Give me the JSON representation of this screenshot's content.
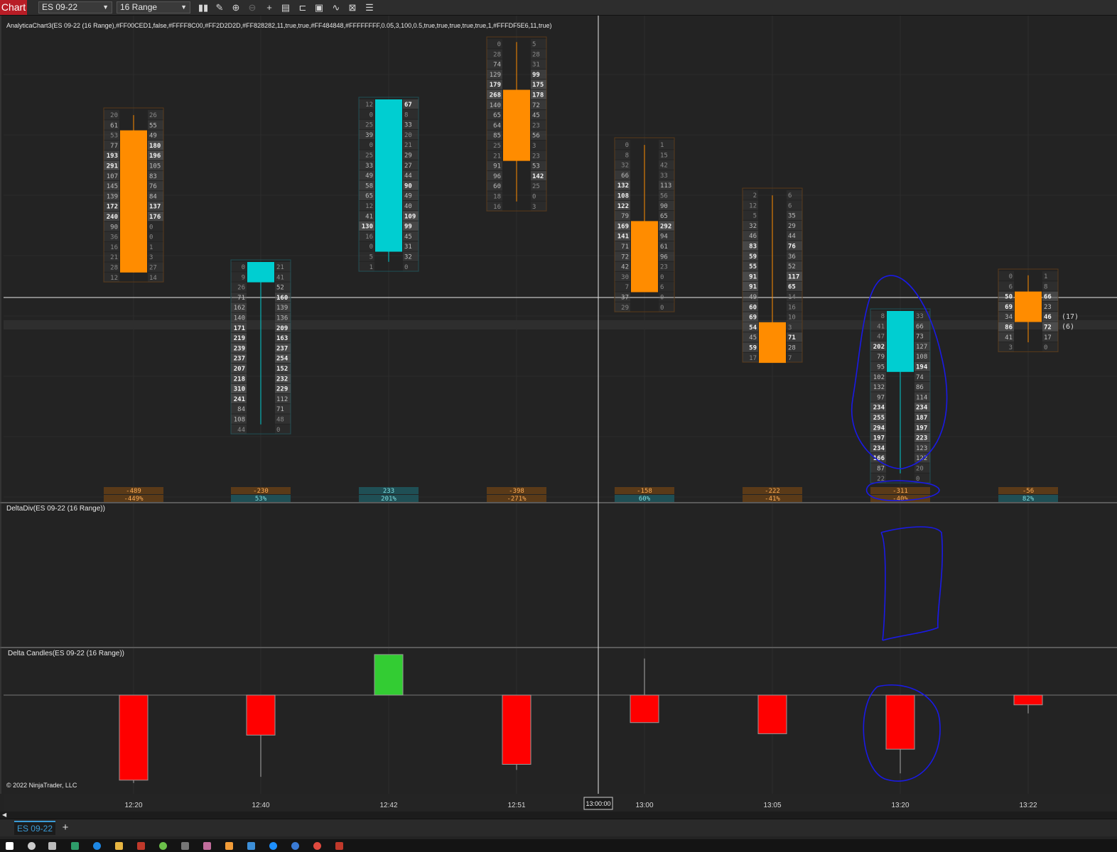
{
  "toolbar": {
    "chart_label": "Chart",
    "instrument": "ES 09-22",
    "interval": "16 Range",
    "icons": [
      "bar-type-icon",
      "draw-tool-icon",
      "zoom-in-icon",
      "zoom-out-icon",
      "crosshair-icon",
      "data-box-icon",
      "properties-icon",
      "screenshot-icon",
      "strategies-icon",
      "indicators-icon",
      "list-icon"
    ]
  },
  "panels": {
    "main_label": "AnalyticaChart3(ES 09-22 (16 Range),#FF00CED1,false,#FFFF8C00,#FF2D2D2D,#FF828282,11,true,true,#FF484848,#FFFFFFFF,0.05,3,100,0.5,true,true,true,true,true,1,#FFFDF5E6,11,true)",
    "delta_div_label": "DeltaDiv(ES 09-22 (16 Range))",
    "delta_candles_label": "Delta Candles(ES 09-22 (16 Range))",
    "copyright": "© 2022 NinjaTrader, LLC"
  },
  "colors": {
    "bg": "#232323",
    "bull": "#00CED1",
    "bear": "#FF8C00",
    "grid": "#2D2D2D",
    "delta_up": "#33CC33",
    "delta_down": "#FF0000",
    "annotation": "#1A1AE6"
  },
  "x_axis": {
    "cursor_time": "13:00:00",
    "labels": [
      "12:20",
      "12:40",
      "12:42",
      "12:51",
      "13:00",
      "13:05",
      "13:20",
      "13:22"
    ]
  },
  "price_markers": [
    "(17)",
    "(6)"
  ],
  "chart_data": {
    "type": "footprint",
    "bars": [
      {
        "time": "12:20",
        "dir": "down",
        "bid": [
          "20",
          "61",
          "53",
          "77",
          "193",
          "291",
          "107",
          "145",
          "139",
          "172",
          "240",
          "90",
          "36",
          "16",
          "21",
          "28",
          "12"
        ],
        "ask": [
          "26",
          "55",
          "49",
          "180",
          "196",
          "105",
          "83",
          "76",
          "84",
          "137",
          "176",
          "0",
          "0",
          "1",
          "3",
          "27",
          "14"
        ],
        "delta": "-489",
        "pct": "-449%"
      },
      {
        "time": "12:40",
        "dir": "up",
        "bid": [
          "0",
          "9",
          "26",
          "71",
          "162",
          "140",
          "171",
          "219",
          "239",
          "237",
          "207",
          "218",
          "310",
          "241",
          "84",
          "108",
          "44"
        ],
        "ask": [
          "21",
          "41",
          "52",
          "160",
          "139",
          "136",
          "209",
          "163",
          "237",
          "254",
          "152",
          "232",
          "229",
          "112",
          "71",
          "48",
          "0"
        ],
        "delta": "-230",
        "pct": "53%"
      },
      {
        "time": "12:42",
        "dir": "up",
        "bid": [
          "12",
          "0",
          "25",
          "39",
          "0",
          "25",
          "33",
          "49",
          "58",
          "65",
          "12",
          "41",
          "130",
          "16",
          "0",
          "5",
          "1"
        ],
        "ask": [
          "67",
          "8",
          "33",
          "20",
          "21",
          "29",
          "27",
          "44",
          "90",
          "49",
          "40",
          "109",
          "99",
          "45",
          "31",
          "32",
          "0"
        ],
        "delta": "233",
        "pct": "201%"
      },
      {
        "time": "12:51",
        "dir": "down",
        "bid": [
          "0",
          "28",
          "74",
          "129",
          "179",
          "268",
          "140",
          "65",
          "64",
          "85",
          "25",
          "21",
          "91",
          "96",
          "60",
          "18",
          "16"
        ],
        "ask": [
          "5",
          "28",
          "31",
          "99",
          "175",
          "178",
          "72",
          "45",
          "23",
          "56",
          "3",
          "23",
          "53",
          "142",
          "25",
          "0",
          "3"
        ],
        "delta": "-398",
        "pct": "-271%"
      },
      {
        "time": "13:00",
        "dir": "down",
        "bid": [
          "0",
          "8",
          "32",
          "66",
          "132",
          "108",
          "122",
          "79",
          "169",
          "141",
          "71",
          "72",
          "42",
          "30",
          "7",
          "37",
          "29"
        ],
        "ask": [
          "1",
          "15",
          "42",
          "33",
          "113",
          "56",
          "90",
          "65",
          "292",
          "94",
          "61",
          "96",
          "23",
          "0",
          "6",
          "0",
          "0"
        ],
        "delta": "-158",
        "pct": "60%"
      },
      {
        "time": "13:05",
        "dir": "down",
        "bid": [
          "2",
          "12",
          "5",
          "32",
          "46",
          "83",
          "59",
          "55",
          "91",
          "91",
          "49",
          "60",
          "69",
          "54",
          "45",
          "59",
          "17"
        ],
        "ask": [
          "6",
          "6",
          "35",
          "29",
          "44",
          "76",
          "36",
          "52",
          "117",
          "65",
          "14",
          "16",
          "10",
          "3",
          "71",
          "28",
          "7"
        ],
        "delta": "-222",
        "pct": "-41%"
      },
      {
        "time": "13:20",
        "dir": "up",
        "bid": [
          "8",
          "41",
          "47",
          "202",
          "79",
          "95",
          "102",
          "132",
          "97",
          "234",
          "255",
          "294",
          "197",
          "234",
          "166",
          "87",
          "22"
        ],
        "ask": [
          "33",
          "66",
          "73",
          "127",
          "108",
          "194",
          "74",
          "86",
          "114",
          "234",
          "187",
          "197",
          "223",
          "123",
          "122",
          "20",
          "0"
        ],
        "delta": "-311",
        "pct": "-40%"
      },
      {
        "time": "13:22",
        "dir": "down",
        "bid": [
          "0",
          "6",
          "50",
          "69",
          "34",
          "86",
          "41",
          "3"
        ],
        "ask": [
          "1",
          "8",
          "66",
          "23",
          "46",
          "72",
          "17",
          "0"
        ],
        "delta": "-56",
        "pct": "82%"
      }
    ],
    "delta_candles": [
      {
        "time": "12:20",
        "open": 0,
        "close": -489,
        "high": 0,
        "low": -505
      },
      {
        "time": "12:40",
        "open": 0,
        "close": -230,
        "high": 0,
        "low": -470
      },
      {
        "time": "12:42",
        "open": 0,
        "close": 233,
        "high": 233,
        "low": 0
      },
      {
        "time": "12:51",
        "open": 0,
        "close": -398,
        "high": 0,
        "low": -430
      },
      {
        "time": "13:00",
        "open": 0,
        "close": -158,
        "high": 210,
        "low": -158
      },
      {
        "time": "13:05",
        "open": 0,
        "close": -222,
        "high": 0,
        "low": -222
      },
      {
        "time": "13:20",
        "open": 0,
        "close": -311,
        "high": 0,
        "low": -450
      },
      {
        "time": "13:22",
        "open": 0,
        "close": -56,
        "high": 0,
        "low": -105
      }
    ]
  },
  "tabs": {
    "active": "ES 09-22",
    "add": "+"
  }
}
